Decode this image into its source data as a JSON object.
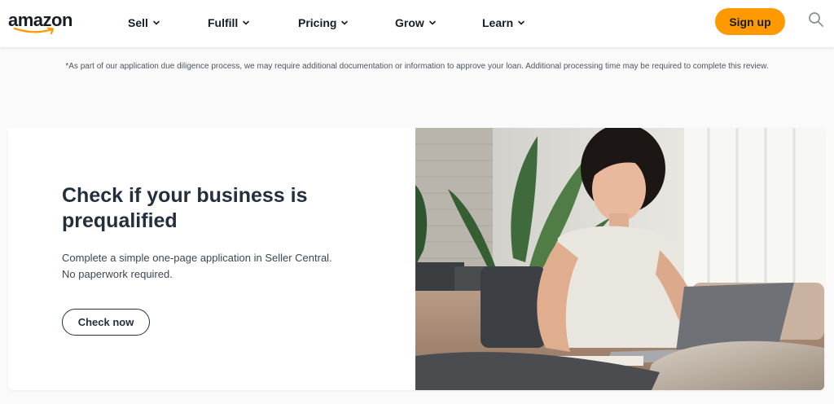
{
  "brand": {
    "logo_text": "amazon",
    "accent": "#ff9900"
  },
  "nav": {
    "items": [
      {
        "label": "Sell"
      },
      {
        "label": "Fulfill"
      },
      {
        "label": "Pricing"
      },
      {
        "label": "Grow"
      },
      {
        "label": "Learn"
      }
    ],
    "signup_label": "Sign up",
    "search_icon": "search-icon"
  },
  "disclaimer": "*As part of our application due diligence process, we may require additional documentation or information to approve your loan. Additional processing time may be required to complete this review.",
  "card": {
    "title": "Check if your business is prequalified",
    "body_line1": "Complete a simple one-page application in Seller Central.",
    "body_line2": "No paperwork required.",
    "button_label": "Check now"
  }
}
